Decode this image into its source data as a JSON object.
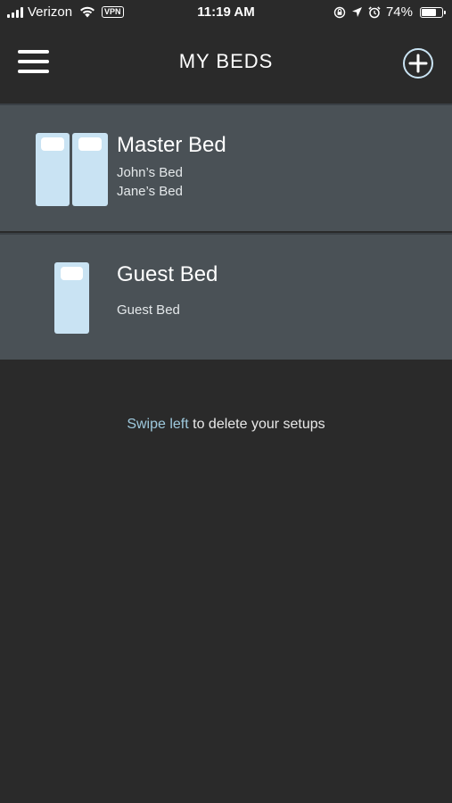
{
  "status_bar": {
    "carrier": "Verizon",
    "vpn": "VPN",
    "time": "11:19 AM",
    "battery": "74%",
    "battery_level": 0.74
  },
  "nav": {
    "title": "MY BEDS",
    "menu_icon": "hamburger-menu-icon",
    "add_icon": "add-circle-icon"
  },
  "beds": [
    {
      "name": "Master Bed",
      "sides": [
        "John’s Bed",
        "Jane’s Bed"
      ],
      "icon": "split-bed-icon"
    },
    {
      "name": "Guest Bed",
      "sides": [
        "Guest Bed"
      ],
      "icon": "single-bed-icon"
    }
  ],
  "hint": {
    "accent": "Swipe left",
    "rest": " to delete your setups"
  },
  "colors": {
    "background": "#2a2a2a",
    "row_background": "#4a5156",
    "accent": "#9ec9dd",
    "mattress": "#c9e3f3"
  }
}
